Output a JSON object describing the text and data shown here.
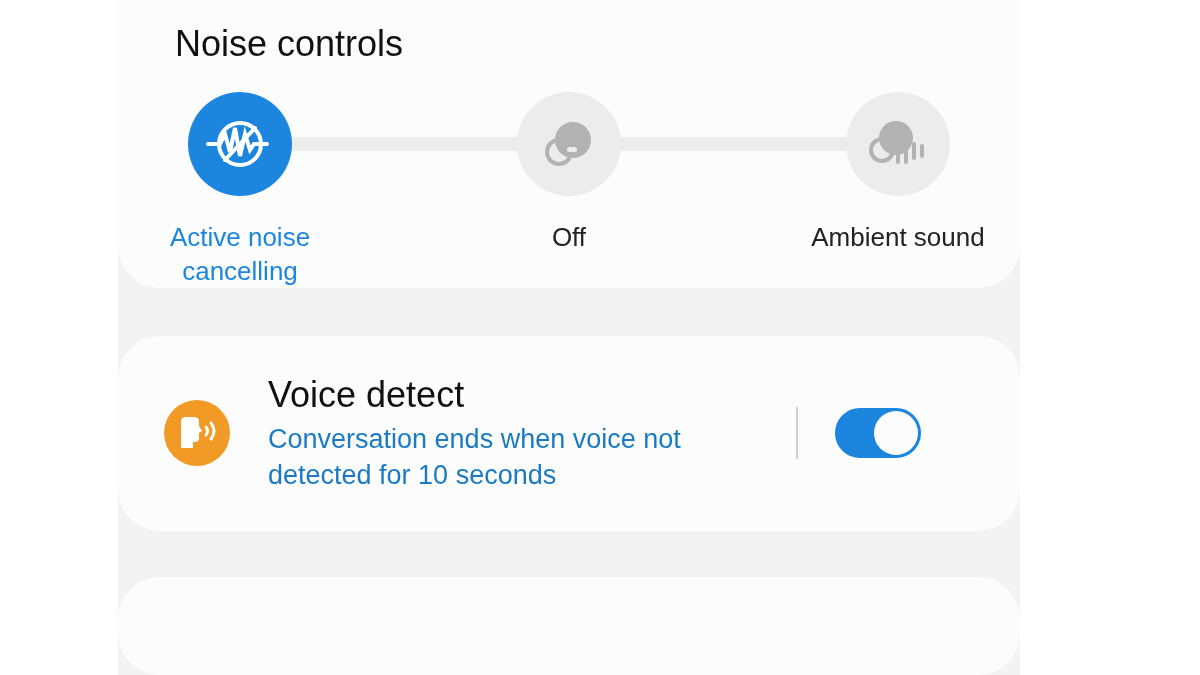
{
  "noise_controls": {
    "title": "Noise controls",
    "modes": [
      {
        "kind": "anc",
        "label": "Active noise cancelling",
        "selected": true
      },
      {
        "kind": "off",
        "label": "Off",
        "selected": false
      },
      {
        "kind": "ambient",
        "label": "Ambient sound",
        "selected": false
      }
    ]
  },
  "voice_detect": {
    "title": "Voice detect",
    "description": "Conversation ends when voice not detected for 10 seconds",
    "on": true
  }
}
